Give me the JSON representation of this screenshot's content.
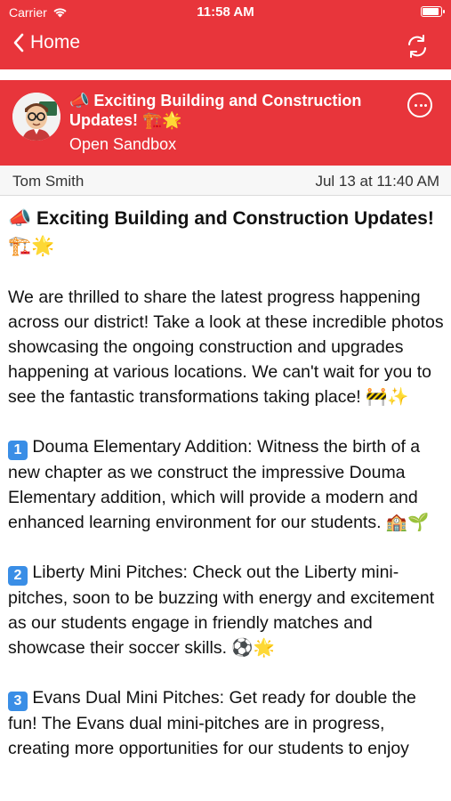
{
  "status_bar": {
    "carrier": "Carrier",
    "time": "11:58 AM"
  },
  "nav": {
    "back_label": "Home"
  },
  "channel": {
    "title": "📣 Exciting Building and Construction Updates! 🏗️🌟",
    "subtitle": "Open Sandbox"
  },
  "post": {
    "author": "Tom Smith",
    "date": "Jul 13 at 11:40 AM",
    "title_text": "📣 Exciting Building and Construction Updates! 🏗️🌟",
    "paragraphs": [
      "We are thrilled to share the latest progress happening across our district! Take a look at these incredible photos showcasing the ongoing construction and upgrades happening at various locations. We can't wait for you to see the fantastic transformations taking place! 🚧✨",
      "Douma Elementary Addition: Witness the birth of a new chapter as we construct the impressive Douma Elementary addition, which will provide a modern and enhanced learning environment for our students. 🏫🌱",
      "Liberty Mini Pitches: Check out the Liberty mini-pitches, soon to be buzzing with energy and excitement as our students engage in friendly matches and showcase their soccer skills. ⚽🌟",
      "Evans Dual Mini Pitches: Get ready for double the fun! The Evans dual mini-pitches are in progress, creating more opportunities for our students to enjoy"
    ],
    "badges": [
      "1",
      "2",
      "3"
    ]
  },
  "colors": {
    "accent": "#e8353b",
    "badge": "#3a8ee6"
  },
  "icons": {
    "back": "chevron-left-icon",
    "refresh": "refresh-icon",
    "more": "more-icon",
    "wifi": "wifi-icon",
    "battery": "battery-icon"
  }
}
